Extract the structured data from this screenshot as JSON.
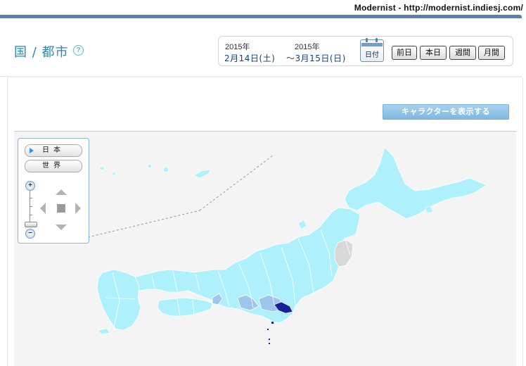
{
  "credit_text": "Modernist - http://modernist.indiesj.com/",
  "page_title": "国 / 都市",
  "help_icon_glyph": "?",
  "date_range": {
    "start_year": "2015年",
    "start_date": "2月14日(土)",
    "end_year": "2015年",
    "end_date": "〜3月15日(日)",
    "calendar_label": "日付"
  },
  "nav_buttons": {
    "prev_day": "前日",
    "today": "本日",
    "week": "週間",
    "month": "月間"
  },
  "character_button": "キャラクターを表示する",
  "region_buttons": {
    "japan": "日本",
    "world": "世界"
  },
  "zoom": {
    "plus": "+",
    "minus": "−"
  },
  "icons": {
    "help": "help-icon",
    "calendar": "calendar-icon",
    "pan_up": "arrow-up-icon",
    "pan_down": "arrow-down-icon",
    "pan_left": "arrow-left-icon",
    "pan_right": "arrow-right-icon",
    "pan_center": "square-icon"
  },
  "colors": {
    "accent_blue": "#2b88b3",
    "map_light": "#aef1fd",
    "map_mid": "#9ec6ec",
    "map_dark": "#1b1f9c",
    "map_none": "#d8d8d8",
    "button_blue": "#7fb6e0"
  }
}
